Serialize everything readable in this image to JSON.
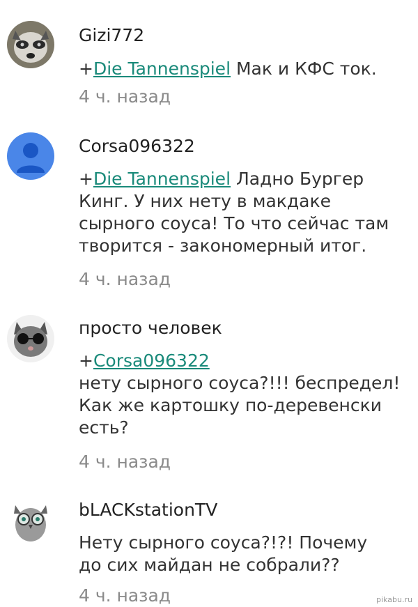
{
  "comments": [
    {
      "author": "Gizi772",
      "plus": "+",
      "mention": "Die Tannenspiel",
      "lines": [
        " Мак и КФС ток."
      ],
      "time": "4 ч. назад"
    },
    {
      "author": "Corsa096322",
      "plus": "+",
      "mention": "Die Tannenspiel",
      "lines": [
        " Ладно Бургер",
        "Кинг. У них нету в макдаке",
        "сырного соуса! То что сейчас там",
        "творится - закономерный итог."
      ],
      "time": "4 ч. назад"
    },
    {
      "author": "просто человек",
      "plus": "+",
      "mention": "Corsa096322",
      "lines": [
        "",
        "нету сырного соуса?!!! беспредел!",
        "Как же картошку по-деревенски",
        "есть?"
      ],
      "time": "4 ч. назад"
    },
    {
      "author": "bLACKstationTV",
      "lines": [
        "Нету сырного соуса?!?! Почему",
        "до сих майдан не собрали??"
      ],
      "time": "4 ч. назад"
    }
  ],
  "watermark": "pikabu.ru",
  "colors": {
    "mention": "#1a8a7a",
    "time": "#8a8a8a",
    "avatar_default_bg": "#4a86e8"
  }
}
